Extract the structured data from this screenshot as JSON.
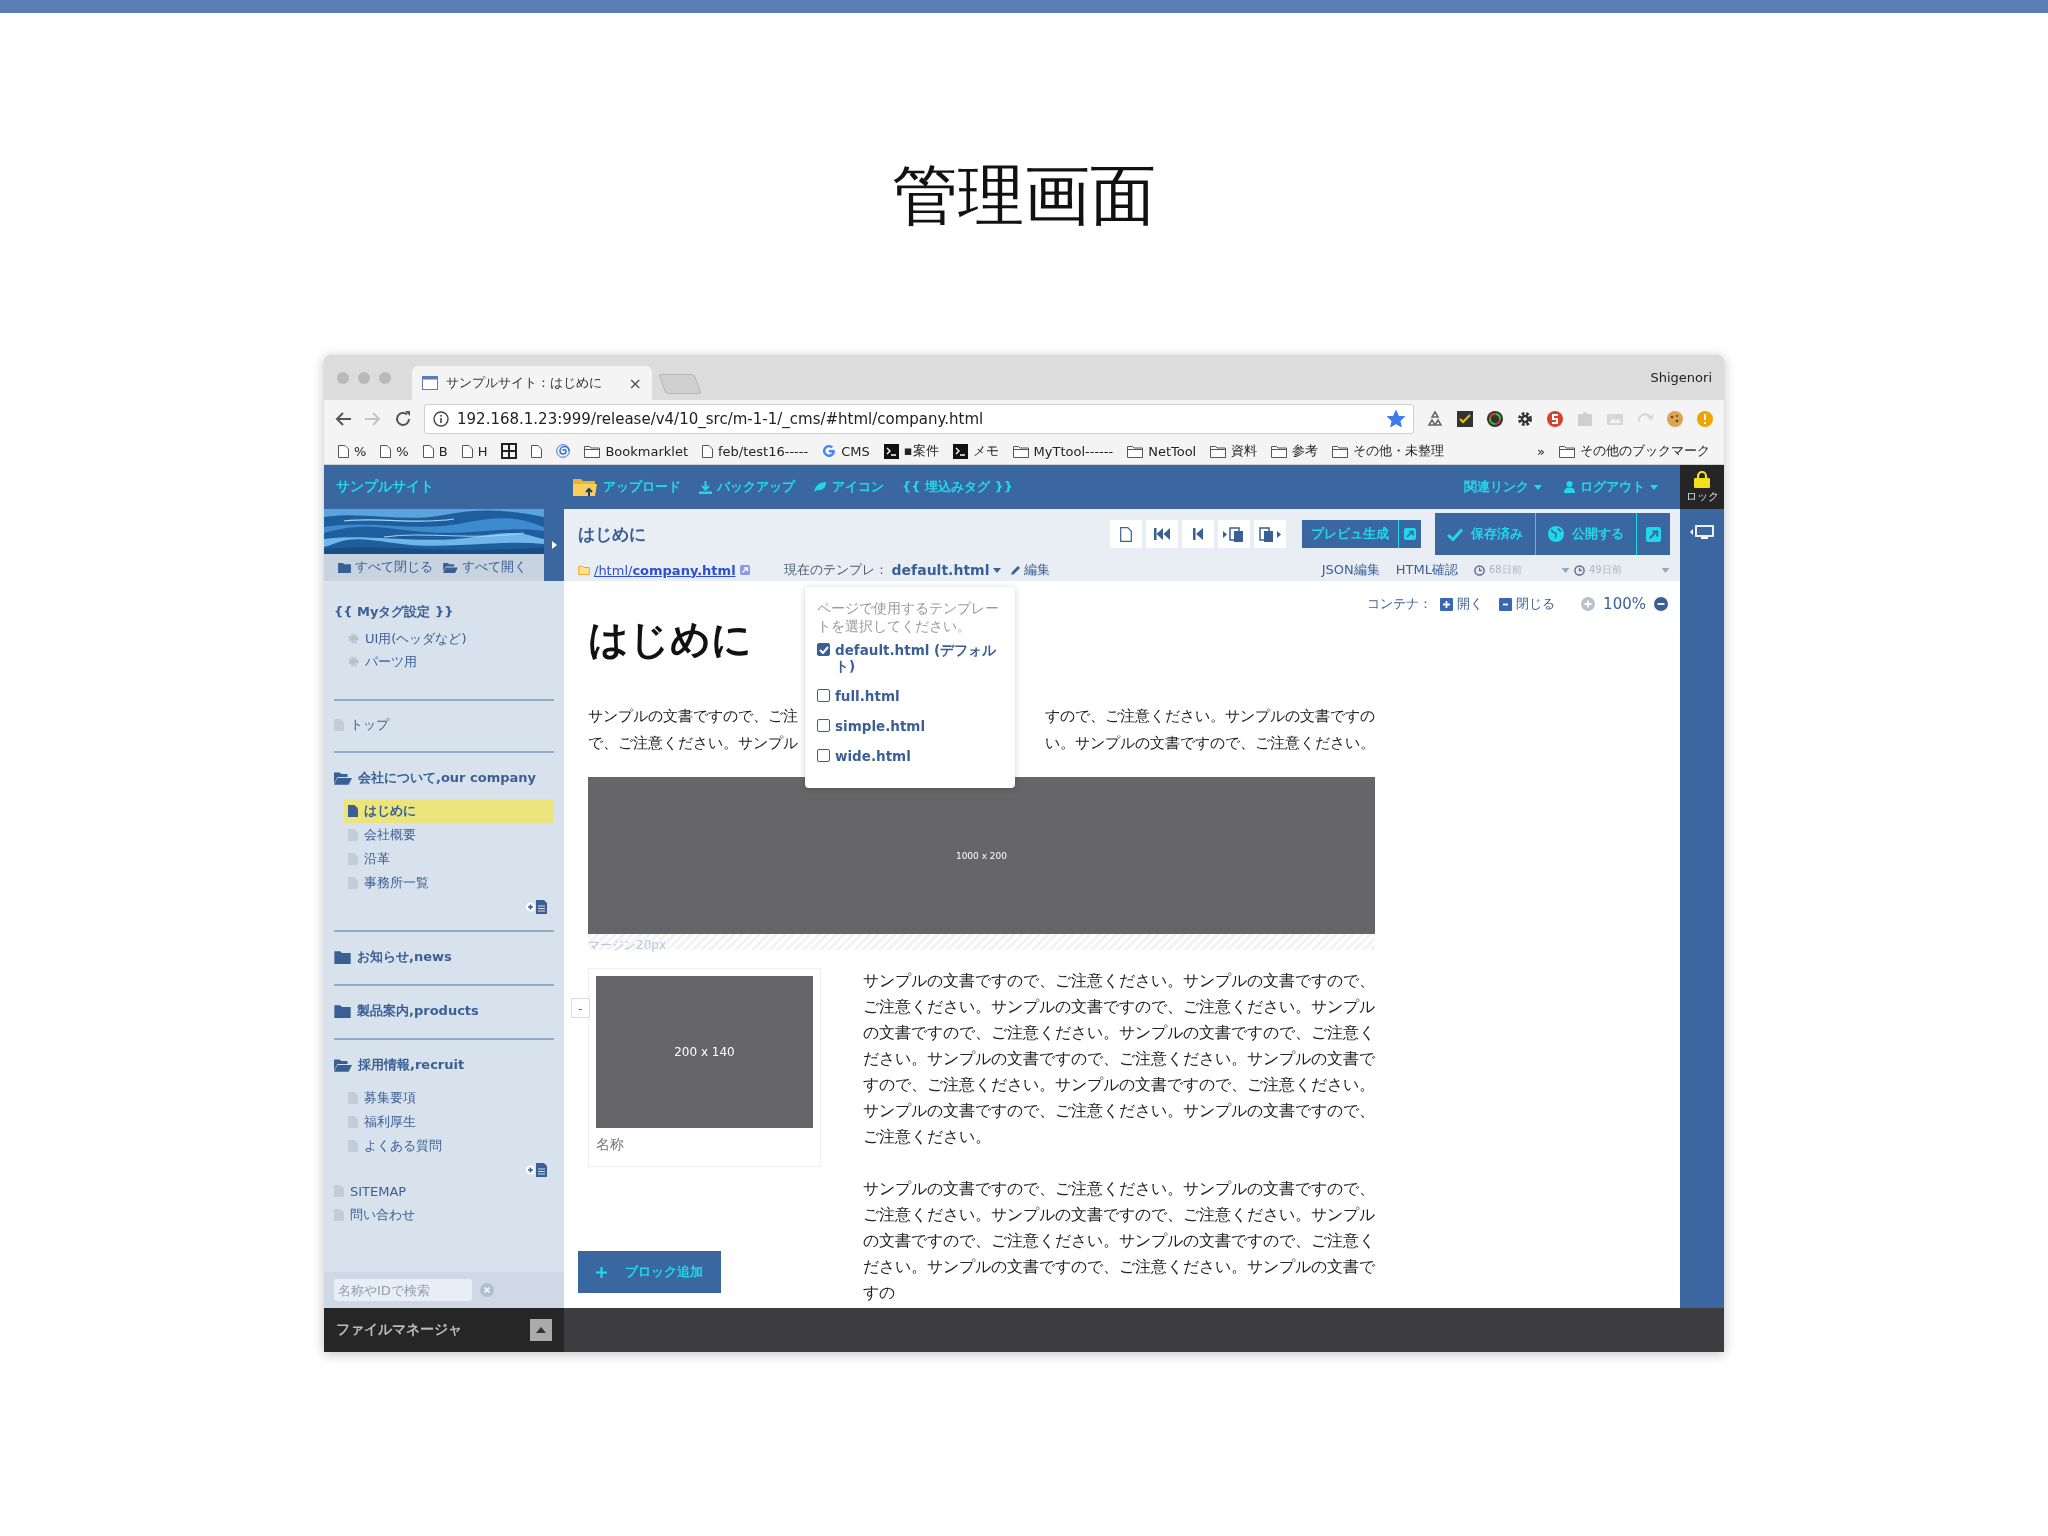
{
  "slide": {
    "title": "管理画面"
  },
  "browser": {
    "tab": {
      "title": "サンプルサイト : はじめに",
      "close": "×"
    },
    "profile": "Shigenori",
    "url": "192.168.1.23:999/release/v4/10_src/m-1-1/_cms/#html/company.html",
    "bookmarked": true,
    "bookmarks": [
      {
        "kind": "page",
        "label": "%"
      },
      {
        "kind": "page",
        "label": "%"
      },
      {
        "kind": "page",
        "label": "B"
      },
      {
        "kind": "page",
        "label": "H"
      },
      {
        "kind": "grid"
      },
      {
        "kind": "page"
      },
      {
        "kind": "swirl"
      },
      {
        "kind": "folder",
        "label": "Bookmarklet"
      },
      {
        "kind": "page",
        "label": "feb/test16-----"
      },
      {
        "kind": "google",
        "label": "CMS"
      },
      {
        "kind": "terminal",
        "label": "▪案件"
      },
      {
        "kind": "terminal",
        "label": "メモ"
      },
      {
        "kind": "folder",
        "label": "MyTtool------"
      },
      {
        "kind": "folder",
        "label": "NetTool"
      },
      {
        "kind": "folder",
        "label": "資料"
      },
      {
        "kind": "folder",
        "label": "参考"
      },
      {
        "kind": "folder",
        "label": "その他・未整理"
      }
    ],
    "bookmarks_more": "»",
    "other_bookmarks": "その他のブックマーク"
  },
  "header": {
    "site_name": "サンプルサイト",
    "nav": [
      {
        "kind": "upload",
        "label": "アップロード"
      },
      {
        "kind": "backup",
        "label": "バックアップ"
      },
      {
        "kind": "icons",
        "label": "アイコン"
      },
      {
        "kind": "tags",
        "label": "{{ 埋込みタグ }}"
      }
    ],
    "menus": [
      {
        "kind": "links",
        "label": "関連リンク"
      },
      {
        "kind": "user",
        "label": "ログアウト"
      }
    ],
    "lock": "ロック"
  },
  "sidebar": {
    "collapse_all": "すべて閉じる",
    "expand_all": "すべて開く",
    "tag_settings": {
      "title": "{{ Myタグ設定 }}",
      "items": [
        "UI用(ヘッダなど)",
        "パーツ用"
      ]
    },
    "sections": [
      [
        {
          "kind": "page",
          "label": "トップ",
          "selected": false
        }
      ],
      [
        {
          "kind": "folder",
          "label": "会社について,our company",
          "expanded": true,
          "children": [
            {
              "kind": "page",
              "label": "はじめに",
              "selected": true
            },
            {
              "kind": "page",
              "label": "会社概要",
              "selected": false
            },
            {
              "kind": "page",
              "label": "沿革",
              "selected": false
            },
            {
              "kind": "page",
              "label": "事務所一覧",
              "selected": false
            }
          ]
        }
      ],
      [
        {
          "kind": "folder",
          "label": "お知らせ,news",
          "expanded": false
        }
      ],
      [
        {
          "kind": "folder",
          "label": "製品案内,products",
          "expanded": false
        }
      ],
      [
        {
          "kind": "folder",
          "label": "採用情報,recruit",
          "expanded": true,
          "children": [
            {
              "kind": "page",
              "label": "募集要項",
              "selected": false
            },
            {
              "kind": "page",
              "label": "福利厚生",
              "selected": false
            },
            {
              "kind": "page",
              "label": "よくある質問",
              "selected": false
            }
          ]
        },
        {
          "kind": "page",
          "label": "SITEMAP",
          "selected": false
        },
        {
          "kind": "page",
          "label": "問い合わせ",
          "selected": false
        }
      ]
    ],
    "search": {
      "placeholder": "名称やIDで検索"
    }
  },
  "page": {
    "title": "はじめに",
    "path": "/html/**company.html**",
    "template_label": "現在のテンプレ：",
    "template": "default.html",
    "edit": "編集",
    "preview": "プレビュ生成",
    "save": "保存済み",
    "publish": "公開する",
    "links": [
      "JSON編集",
      "HTML確認"
    ],
    "history": [
      "68日前",
      "49日前"
    ]
  },
  "template_dropdown": {
    "hint": "ページで使用するテンプレートを選択してください。",
    "options": [
      {
        "label": "default.html (デフォルト)",
        "checked": true
      },
      {
        "label": "full.html",
        "checked": false
      },
      {
        "label": "simple.html",
        "checked": false
      },
      {
        "label": "wide.html",
        "checked": false
      }
    ]
  },
  "editor": {
    "container_label": "コンテナ：",
    "expand": "開く",
    "collapse": "閉じる",
    "zoom": "100%",
    "heading": "はじめに",
    "intro_lines": [
      {
        "left": "サンプルの文書ですので、ご注",
        "right": "すので、ご注意ください。サンプルの文書ですの"
      },
      {
        "left": "で、ご注意ください。サンプル",
        "right": "い。サンプルの文書ですので、ご注意ください。"
      }
    ],
    "banner_image": "1000 x 200",
    "margin_label": "マージン20px",
    "card": {
      "image": "200 x 140",
      "caption": "名称",
      "toggle": "-"
    },
    "paragraphs": [
      "サンプルの文書ですので、ご注意ください。サンプルの文書ですので、ご注意ください。サンプルの文書ですので、ご注意ください。サンプルの文書ですので、ご注意ください。サンプルの文書ですので、ご注意ください。サンプルの文書ですので、ご注意ください。サンプルの文書ですので、ご注意ください。サンプルの文書ですので、ご注意ください。サンプルの文書ですので、ご注意ください。サンプルの文書ですので、ご注意ください。",
      "サンプルの文書ですので、ご注意ください。サンプルの文書ですので、ご注意ください。サンプルの文書ですので、ご注意ください。サンプルの文書ですので、ご注意ください。サンプルの文書ですので、ご注意ください。サンプルの文書ですので、ご注意ください。サンプルの文書ですの"
    ],
    "add_block": "ブロック追加"
  },
  "file_manager": {
    "title": "ファイルマネージャ"
  }
}
